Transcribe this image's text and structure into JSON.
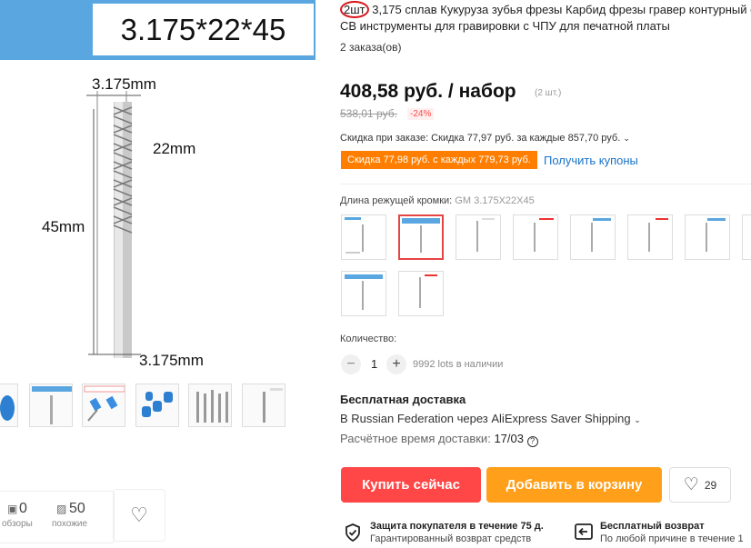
{
  "gallery": {
    "banner_text": "3.175*22*45",
    "dim_top": "3.175mm",
    "dim_mid": "22mm",
    "dim_left": "45mm",
    "dim_bottom": "3.175mm",
    "reviews_count": "0",
    "reviews_label": "обзоры",
    "similar_count": "50",
    "similar_label": "похожие"
  },
  "product": {
    "title_highlight": "2шт",
    "title_line1": " 3,175 сплав Кукуруза зубья фрезы Карбид фрезы гравер контурный с",
    "title_line2": "СВ инструменты для гравировки с ЧПУ для печатной платы",
    "orders": "2 заказа(ов)",
    "price": "408,58 руб. / набор",
    "price_unit": "(2 шт.)",
    "old_price": "538,01 руб.",
    "discount": "-24%",
    "order_discount": "Скидка при заказе: Скидка 77,97 руб. за каждые 857,70 руб.",
    "coupon_badge": "Скидка 77,98 руб. с каждых 779,73 руб.",
    "get_coupons": "Получить купоны",
    "cut_length_label": "Длина режущей кромки:",
    "cut_length_value": "GM 3.175X22X45",
    "quantity_label": "Количество:",
    "quantity_value": "1",
    "stock": "9992 lots в наличии",
    "shipping_title": "Бесплатная доставка",
    "shipping_desc": "В Russian Federation через AliExpress Saver Shipping",
    "delivery_label": "Расчётное время доставки:",
    "delivery_date": "17/03",
    "buy_now": "Купить сейчас",
    "add_to_cart": "Добавить в корзину",
    "wishlist_count": "29",
    "protection_title": "Защита покупателя в течение 75 д.",
    "protection_sub": "Гарантированный возврат средств",
    "return_title": "Бесплатный возврат",
    "return_sub": "По любой причине в течение 1"
  },
  "colors": {
    "accent": "#ff4747",
    "orange": "#ff9f1a",
    "coupon": "#ff7e00",
    "link": "#1a73c7",
    "banner": "#5aa6e0"
  }
}
